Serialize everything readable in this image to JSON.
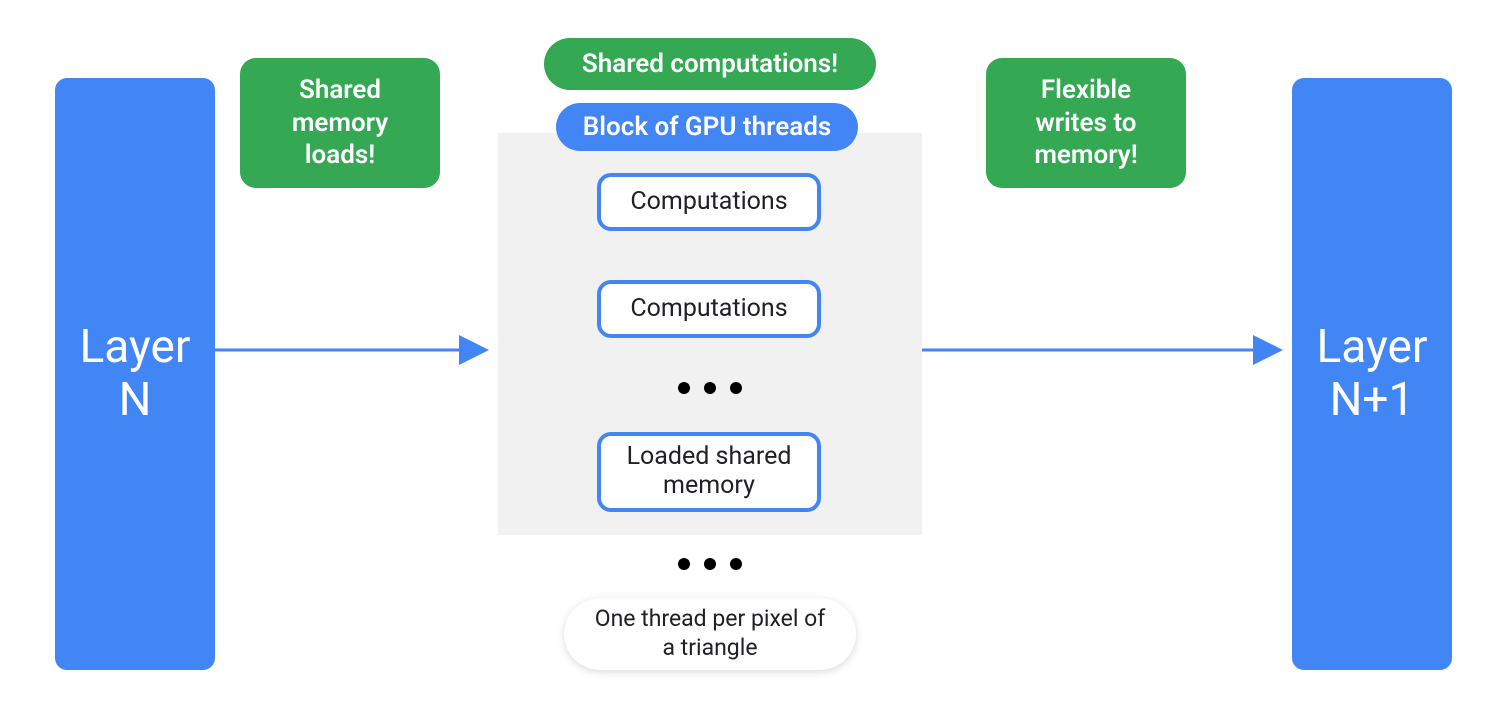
{
  "colors": {
    "blue": "#4285f4",
    "green": "#34a853",
    "grey": "#f1f1f1",
    "text_dark": "#202124",
    "white": "#ffffff"
  },
  "left_layer": {
    "line1": "Layer",
    "line2": "N"
  },
  "right_layer": {
    "line1": "Layer",
    "line2": "N+1"
  },
  "callouts": {
    "shared_loads": "Shared memory loads!",
    "shared_computations": "Shared computations!",
    "flexible_writes": "Flexible writes to memory!"
  },
  "gpu_block": {
    "title": "Block of GPU threads",
    "items": {
      "comp1": "Computations",
      "comp2": "Computations",
      "shared_mem": "Loaded shared memory"
    }
  },
  "footer_pill": "One thread per pixel of a triangle"
}
